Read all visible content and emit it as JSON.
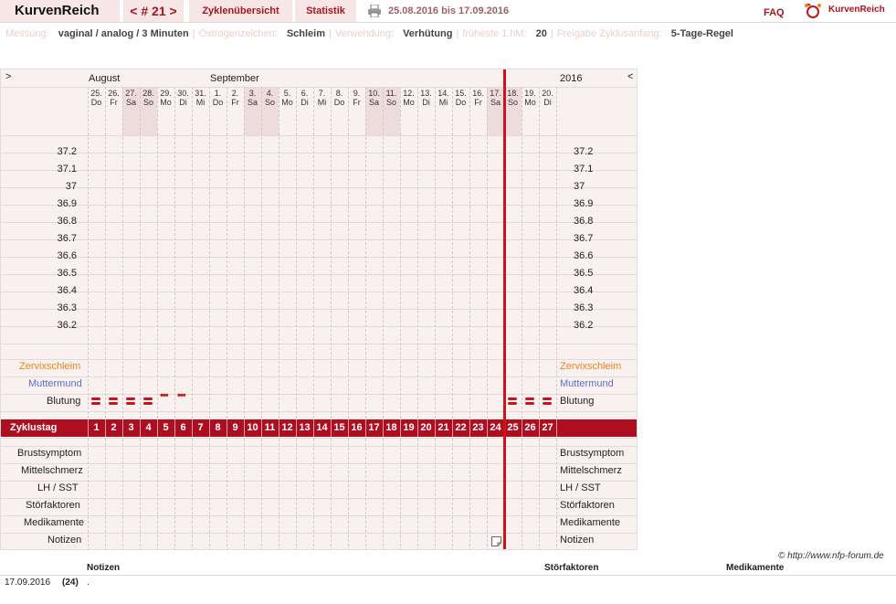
{
  "app": {
    "title": "KurvenReich",
    "brand": "KurvenReich"
  },
  "nav": {
    "cycle": "< # 21 >",
    "overview": "Zyklenübersicht",
    "stats": "Statistik",
    "faq": "FAQ"
  },
  "date_range": "25.08.2016 bis 17.09.2016",
  "settings": [
    {
      "key": "Messung:",
      "value": "vaginal / analog / 3 Minuten"
    },
    {
      "key": "Östrogenzeichen:",
      "value": "Schleim"
    },
    {
      "key": "Verwendung:",
      "value": "Verhütung"
    },
    {
      "key": "früheste 1.hM:",
      "value": "20"
    },
    {
      "key": "Freigabe Zyklusanfang:",
      "value": "5-Tage-Regel"
    }
  ],
  "chart": {
    "nav_left": ">",
    "nav_right": "<",
    "year": "2016",
    "months": [
      {
        "label": "August",
        "day_index": 0
      },
      {
        "label": "September",
        "day_index": 7
      }
    ],
    "days": [
      {
        "d": "25.",
        "w": "Do",
        "weekend": false
      },
      {
        "d": "26.",
        "w": "Fr",
        "weekend": false
      },
      {
        "d": "27.",
        "w": "Sa",
        "weekend": true
      },
      {
        "d": "28.",
        "w": "So",
        "weekend": true
      },
      {
        "d": "29.",
        "w": "Mo",
        "weekend": false
      },
      {
        "d": "30.",
        "w": "Di",
        "weekend": false
      },
      {
        "d": "31.",
        "w": "Mi",
        "weekend": false
      },
      {
        "d": "1.",
        "w": "Do",
        "weekend": false
      },
      {
        "d": "2.",
        "w": "Fr",
        "weekend": false
      },
      {
        "d": "3.",
        "w": "Sa",
        "weekend": true
      },
      {
        "d": "4.",
        "w": "So",
        "weekend": true
      },
      {
        "d": "5.",
        "w": "Mo",
        "weekend": false
      },
      {
        "d": "6.",
        "w": "Di",
        "weekend": false
      },
      {
        "d": "7.",
        "w": "Mi",
        "weekend": false
      },
      {
        "d": "8.",
        "w": "Do",
        "weekend": false
      },
      {
        "d": "9.",
        "w": "Fr",
        "weekend": false
      },
      {
        "d": "10.",
        "w": "Sa",
        "weekend": true
      },
      {
        "d": "11.",
        "w": "So",
        "weekend": true
      },
      {
        "d": "12.",
        "w": "Mo",
        "weekend": false
      },
      {
        "d": "13.",
        "w": "Di",
        "weekend": false
      },
      {
        "d": "14.",
        "w": "Mi",
        "weekend": false
      },
      {
        "d": "15.",
        "w": "Do",
        "weekend": false
      },
      {
        "d": "16.",
        "w": "Fr",
        "weekend": false
      },
      {
        "d": "17.",
        "w": "Sa",
        "weekend": true
      },
      {
        "d": "18.",
        "w": "So",
        "weekend": true
      },
      {
        "d": "19.",
        "w": "Mo",
        "weekend": false
      },
      {
        "d": "20.",
        "w": "Di",
        "weekend": false
      }
    ],
    "temperatures": [
      "37.2",
      "37.1",
      "37",
      "36.9",
      "36.8",
      "36.7",
      "36.6",
      "36.5",
      "36.4",
      "36.3",
      "36.2"
    ],
    "rows": {
      "cervix": "Zervixschleim",
      "cervix_color": "#e8861a",
      "os": "Muttermund",
      "os_color": "#5870c8",
      "bleeding": "Blutung",
      "cycle_day": "Zyklustag",
      "breast": "Brustsymptom",
      "midpain": "Mittelschmerz",
      "lh": "LH / SST",
      "disturb": "Störfaktoren",
      "meds": "Medikamente",
      "notes": "Notizen"
    },
    "bleeding": [
      {
        "day_index": 0,
        "kind": "strong"
      },
      {
        "day_index": 1,
        "kind": "strong"
      },
      {
        "day_index": 2,
        "kind": "strong"
      },
      {
        "day_index": 3,
        "kind": "strong"
      },
      {
        "day_index": 4,
        "kind": "spotting"
      },
      {
        "day_index": 5,
        "kind": "spotting"
      },
      {
        "day_index": 24,
        "kind": "strong"
      },
      {
        "day_index": 25,
        "kind": "strong"
      },
      {
        "day_index": 26,
        "kind": "strong"
      }
    ],
    "spotting_symbol": "•••",
    "cycle_days": [
      "1",
      "2",
      "3",
      "4",
      "5",
      "6",
      "7",
      "8",
      "9",
      "10",
      "11",
      "12",
      "13",
      "14",
      "15",
      "16",
      "17",
      "18",
      "19",
      "20",
      "21",
      "22",
      "23",
      "24",
      "25",
      "26",
      "27"
    ],
    "today_index": 23,
    "note_icon_day_index": 23,
    "accent": "#ad0f20"
  },
  "copyright": "© http://www.nfp-forum.de",
  "notes_table": {
    "headers": {
      "notes": "Notizen",
      "disturb": "Störfaktoren",
      "meds": "Medikamente"
    },
    "rows": [
      {
        "date": "17.09.2016",
        "day": "(24)",
        "note": "."
      }
    ]
  }
}
